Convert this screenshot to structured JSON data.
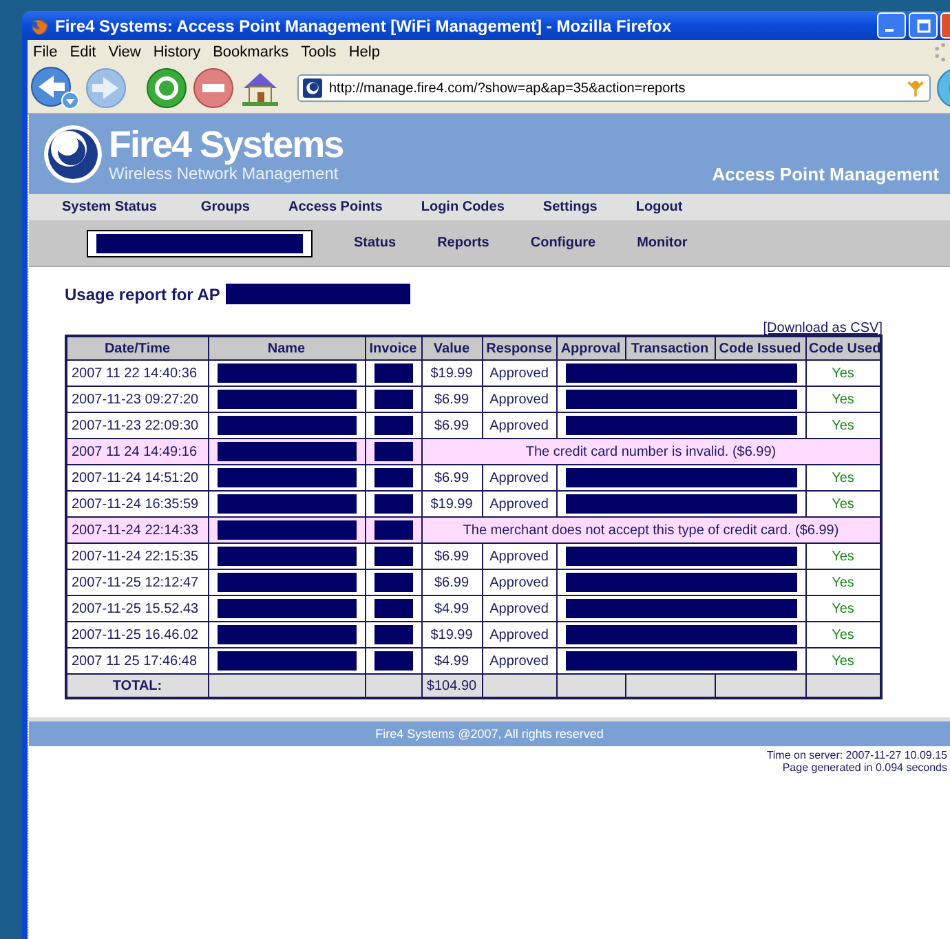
{
  "window": {
    "title": "Fire4 Systems: Access Point Management [WiFi Management] - Mozilla Firefox"
  },
  "menu": [
    "File",
    "Edit",
    "View",
    "History",
    "Bookmarks",
    "Tools",
    "Help"
  ],
  "address": {
    "value": "http://manage.fire4.com/?show=ap&ap=35&action=reports"
  },
  "header": {
    "brand": "Fire4 Systems",
    "tagline": "Wireless Network Management",
    "section": "Access Point Management"
  },
  "nav": [
    {
      "label": "System Status"
    },
    {
      "label": "Groups"
    },
    {
      "label": "Access Points"
    },
    {
      "label": "Login Codes"
    },
    {
      "label": "Settings"
    },
    {
      "label": "Logout"
    }
  ],
  "subnav": {
    "selector_redacted": true,
    "items": [
      {
        "label": "Status"
      },
      {
        "label": "Reports"
      },
      {
        "label": "Configure"
      },
      {
        "label": "Monitor"
      }
    ]
  },
  "report": {
    "title": "Usage report for AP",
    "ap_redacted": true,
    "download": "[Download as CSV]"
  },
  "table": {
    "columns": [
      "Date/Time",
      "Name",
      "Invoice",
      "Value",
      "Response",
      "Approval",
      "Transaction",
      "Code Issued",
      "Code Used"
    ],
    "rows": [
      {
        "kind": "approved",
        "date": "2007 11 22 14:40:36",
        "value": "$19.99",
        "response": "Approved",
        "code_used": "Yes"
      },
      {
        "kind": "approved",
        "date": "2007-11-23 09:27:20",
        "value": "$6.99",
        "response": "Approved",
        "code_used": "Yes"
      },
      {
        "kind": "approved",
        "date": "2007-11-23 22:09:30",
        "value": "$6.99",
        "response": "Approved",
        "code_used": "Yes"
      },
      {
        "kind": "declined",
        "date": "2007 11 24 14:49:16",
        "message": "The credit card number is invalid. ($6.99)"
      },
      {
        "kind": "approved",
        "date": "2007-11-24 14:51:20",
        "value": "$6.99",
        "response": "Approved",
        "code_used": "Yes"
      },
      {
        "kind": "approved",
        "date": "2007-11-24 16:35:59",
        "value": "$19.99",
        "response": "Approved",
        "code_used": "Yes"
      },
      {
        "kind": "declined",
        "date": "2007-11-24 22:14:33",
        "message": "The merchant does not accept this type of credit card. ($6.99)"
      },
      {
        "kind": "approved",
        "date": "2007-11-24 22:15:35",
        "value": "$6.99",
        "response": "Approved",
        "code_used": "Yes"
      },
      {
        "kind": "approved",
        "date": "2007-11-25 12:12:47",
        "value": "$6.99",
        "response": "Approved",
        "code_used": "Yes"
      },
      {
        "kind": "approved",
        "date": "2007-11-25 15.52.43",
        "value": "$4.99",
        "response": "Approved",
        "code_used": "Yes"
      },
      {
        "kind": "approved",
        "date": "2007-11-25 16.46.02",
        "value": "$19.99",
        "response": "Approved",
        "code_used": "Yes"
      },
      {
        "kind": "approved",
        "date": "2007 11 25 17:46:48",
        "value": "$4.99",
        "response": "Approved",
        "code_used": "Yes"
      }
    ],
    "total": {
      "label": "TOTAL:",
      "value": "$104.90"
    }
  },
  "footer": {
    "copyright": "Fire4 Systems @2007, All rights reserved",
    "server_time": "Time on server: 2007-11-27  10.09.15",
    "generated": "Page generated in 0.094 seconds"
  }
}
